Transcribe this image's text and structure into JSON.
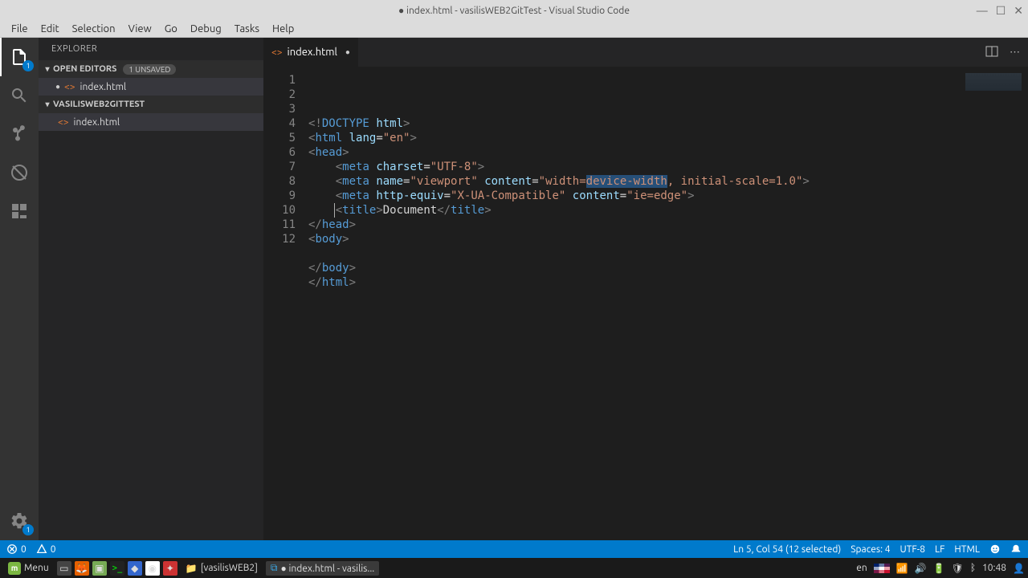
{
  "window": {
    "title": "● index.html - vasilisWEB2GitTest - Visual Studio Code"
  },
  "menubar": [
    "File",
    "Edit",
    "Selection",
    "View",
    "Go",
    "Debug",
    "Tasks",
    "Help"
  ],
  "activitybar": {
    "explorer_badge": "1",
    "settings_badge": "1"
  },
  "sidebar": {
    "title": "EXPLORER",
    "open_editors": {
      "label": "OPEN EDITORS",
      "badge": "1 UNSAVED",
      "files": [
        {
          "name": "index.html",
          "modified": true
        }
      ]
    },
    "project": {
      "label": "VASILISWEB2GITTEST",
      "files": [
        {
          "name": "index.html"
        }
      ]
    }
  },
  "tab": {
    "filename": "index.html",
    "modified": true
  },
  "code": {
    "lines": [
      {
        "n": 1,
        "html": "<span class='tok-brk'>&lt;!</span><span class='tok-tag'>DOCTYPE</span> <span class='tok-attr'>html</span><span class='tok-brk'>&gt;</span>"
      },
      {
        "n": 2,
        "html": "<span class='tok-brk'>&lt;</span><span class='tok-tag'>html</span> <span class='tok-attr'>lang</span>=<span class='tok-str'>\"en\"</span><span class='tok-brk'>&gt;</span>"
      },
      {
        "n": 3,
        "html": "<span class='tok-brk'>&lt;</span><span class='tok-tag'>head</span><span class='tok-brk'>&gt;</span>"
      },
      {
        "n": 4,
        "html": "    <span class='tok-brk'>&lt;</span><span class='tok-tag'>meta</span> <span class='tok-attr'>charset</span>=<span class='tok-str'>\"UTF-8\"</span><span class='tok-brk'>&gt;</span>"
      },
      {
        "n": 5,
        "html": "    <span class='tok-brk'>&lt;</span><span class='tok-tag'>meta</span> <span class='tok-attr'>name</span>=<span class='tok-str'>\"viewport\"</span> <span class='tok-attr'>content</span>=<span class='tok-str'>\"width=<span class='sel'>device-width</span>, initial-scale=1.0\"</span><span class='tok-brk'>&gt;</span>"
      },
      {
        "n": 6,
        "html": "    <span class='tok-brk'>&lt;</span><span class='tok-tag'>meta</span> <span class='tok-attr'>http-equiv</span>=<span class='tok-str'>\"X-UA-Compatible\"</span> <span class='tok-attr'>content</span>=<span class='tok-str'>\"ie=edge\"</span><span class='tok-brk'>&gt;</span>"
      },
      {
        "n": 7,
        "html": "    <span class='tok-brk'>&lt;</span><span class='tok-tag'>title</span><span class='tok-brk'>&gt;</span><span class='tok-txt'>Document</span><span class='tok-brk'>&lt;/</span><span class='tok-tag'>title</span><span class='tok-brk'>&gt;</span>"
      },
      {
        "n": 8,
        "html": "<span class='tok-brk'>&lt;/</span><span class='tok-tag'>head</span><span class='tok-brk'>&gt;</span>"
      },
      {
        "n": 9,
        "html": "<span class='tok-brk'>&lt;</span><span class='tok-tag'>body</span><span class='tok-brk'>&gt;</span>"
      },
      {
        "n": 10,
        "html": "    "
      },
      {
        "n": 11,
        "html": "<span class='tok-brk'>&lt;/</span><span class='tok-tag'>body</span><span class='tok-brk'>&gt;</span>"
      },
      {
        "n": 12,
        "html": "<span class='tok-brk'>&lt;/</span><span class='tok-tag'>html</span><span class='tok-brk'>&gt;</span>"
      }
    ]
  },
  "statusbar": {
    "errors": "0",
    "warnings": "0",
    "cursor": "Ln 5, Col 54 (12 selected)",
    "spaces": "Spaces: 4",
    "encoding": "UTF-8",
    "eol": "LF",
    "lang": "HTML"
  },
  "taskbar": {
    "menu": "Menu",
    "folder_task": "[vasilisWEB2]",
    "vscode_task": "● index.html - vasilis...",
    "lang": "en",
    "time": "10:48"
  }
}
